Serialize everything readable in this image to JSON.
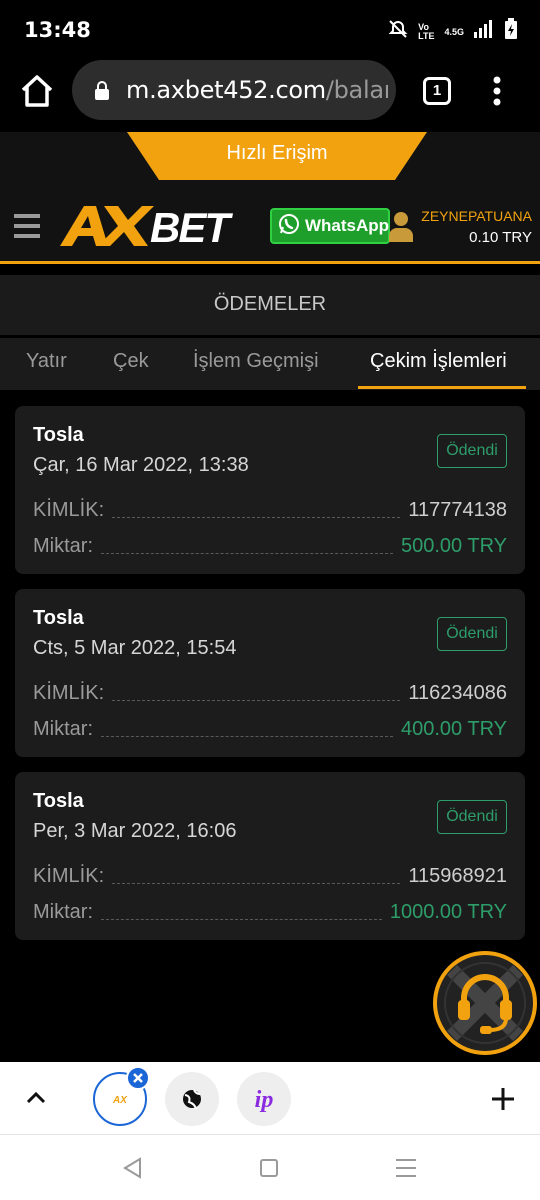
{
  "status_bar": {
    "time": "13:48",
    "network": "4.5G"
  },
  "browser": {
    "url_host": "m.axbet452.com",
    "url_path": "/balanc",
    "tab_count": "1"
  },
  "header": {
    "quick_access": "Hızlı Erişim",
    "logo": "AXBET",
    "whatsapp": "WhatsApp",
    "username": "ZEYNEPATUANA",
    "balance": "0.10 TRY"
  },
  "page_title": "ÖDEMELER",
  "tabs": [
    {
      "label": "Yatır"
    },
    {
      "label": "Çek"
    },
    {
      "label": "İşlem Geçmişi"
    },
    {
      "label": "Çekim İşlemleri",
      "active": true
    }
  ],
  "labels": {
    "id": "KİMLİK:",
    "amount": "Miktar:"
  },
  "withdrawals": [
    {
      "method": "Tosla",
      "date": "Çar, 16 Mar 2022, 13:38",
      "status": "Ödendi",
      "id": "117774138",
      "amount": "500.00 TRY"
    },
    {
      "method": "Tosla",
      "date": "Cts, 5 Mar 2022, 15:54",
      "status": "Ödendi",
      "id": "116234086",
      "amount": "400.00 TRY"
    },
    {
      "method": "Tosla",
      "date": "Per, 3 Mar 2022, 16:06",
      "status": "Ödendi",
      "id": "115968921",
      "amount": "1000.00 TRY"
    }
  ],
  "colors": {
    "accent": "#f2a20f",
    "paid": "#2d9d6a",
    "whatsapp": "#1e9e2a"
  },
  "icons": [
    "home-icon",
    "lock-icon",
    "menu-dots-icon",
    "hamburger-icon",
    "whatsapp-icon",
    "user-icon",
    "headset-icon",
    "chevron-up-icon",
    "globe-icon",
    "plus-icon",
    "close-icon"
  ]
}
